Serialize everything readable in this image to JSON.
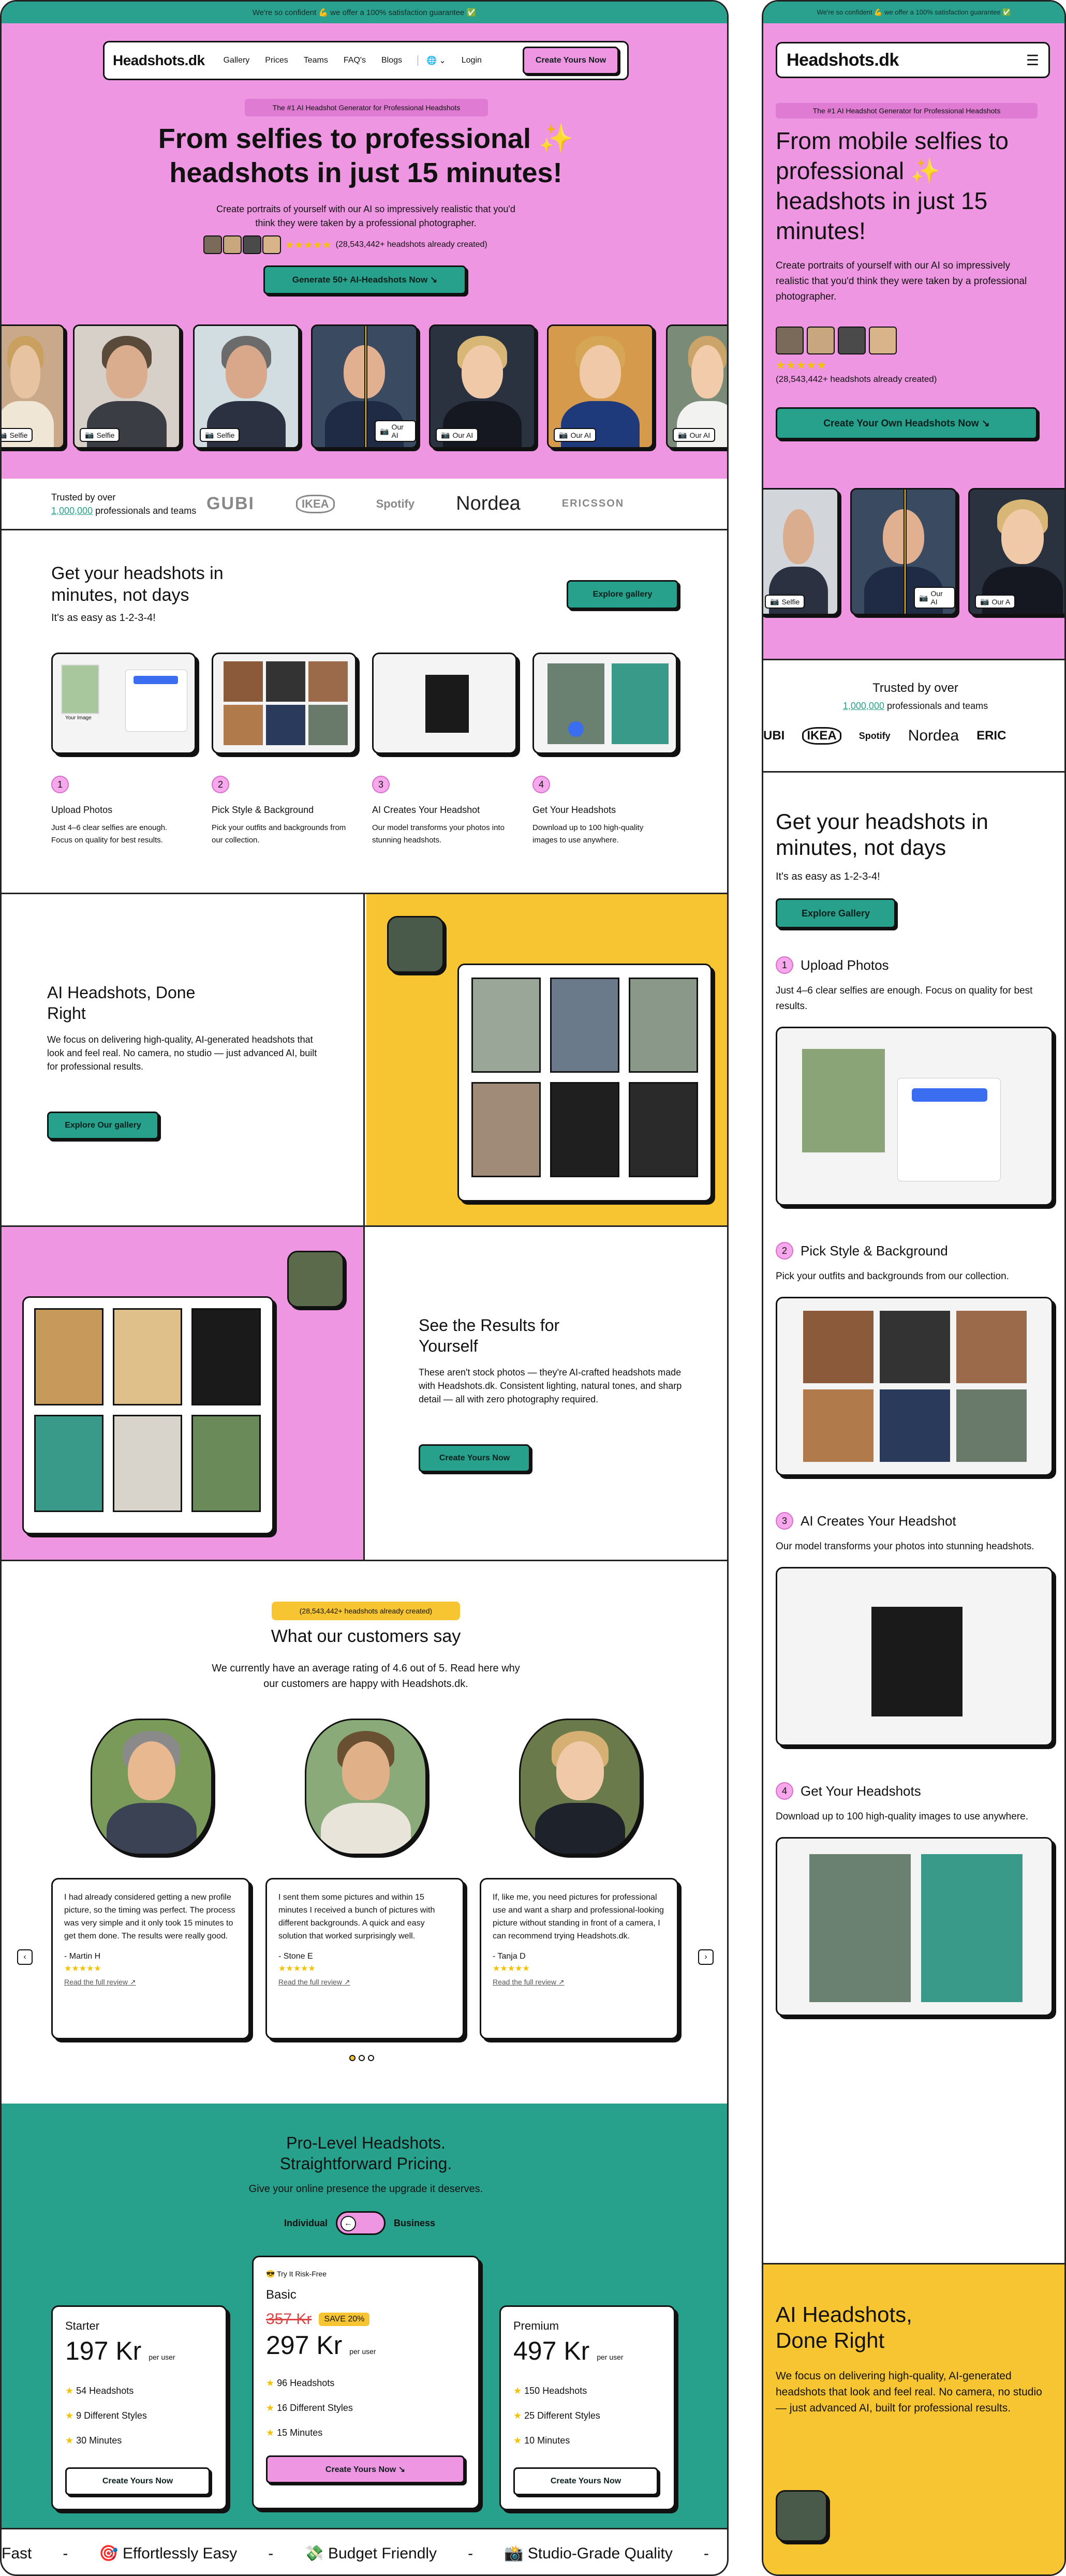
{
  "banner": "We're so confident 💪 we offer a 100% satisfaction guarantee ✅",
  "brand": "Headshots.dk",
  "nav": {
    "gallery": "Gallery",
    "prices": "Prices",
    "teams": "Teams",
    "faqs": "FAQ's",
    "blogs": "Blogs",
    "login": "Login",
    "cta": "Create Yours Now"
  },
  "hero": {
    "badge": "The #1 AI Headshot Generator for Professional Headshots",
    "title_line1": "From selfies to professional ✨",
    "title_line2": "headshots in just 15 minutes!",
    "subtitle": "Create portraits of yourself with our AI so impressively realistic that you'd think they were taken by a professional photographer.",
    "count_text": "(28,543,442+ headshots already created)",
    "cta": "Generate 50+ AI-Headshots Now ↘",
    "tags": [
      "Selfie",
      "Selfie",
      "Selfie",
      "Our AI",
      "Our AI",
      "Our AI",
      "Our AI"
    ]
  },
  "trusted": {
    "line1": "Trusted by over",
    "count": "1,000,000",
    "line2": "professionals and teams",
    "logos": [
      "GUBI",
      "IKEA",
      "Spotify",
      "Nordea",
      "ERICSSON"
    ]
  },
  "steps": {
    "title": "Get your headshots in minutes, not days",
    "subtitle": "It's as easy as 1-2-3-4!",
    "explore": "Explore gallery",
    "items": [
      {
        "num": "1",
        "title": "Upload Photos",
        "desc": "Just 4–6 clear selfies are enough. Focus on quality for best results."
      },
      {
        "num": "2",
        "title": "Pick Style & Background",
        "desc": "Pick your outfits and backgrounds from our collection."
      },
      {
        "num": "3",
        "title": "AI Creates Your Headshot",
        "desc": "Our model transforms your photos into stunning headshots."
      },
      {
        "num": "4",
        "title": "Get Your Headshots",
        "desc": "Download up to 100 high-quality images to use anywhere."
      }
    ],
    "upload_mock": {
      "upload": "Upload",
      "from_phone": "Upload from phone",
      "recent": "Select Recent Photos",
      "your_image": "Your Image"
    }
  },
  "done_right": {
    "title": "AI Headshots, Done Right",
    "body": "We focus on delivering high-quality, AI-generated headshots that look and feel real. No camera, no studio — just advanced AI, built for professional results.",
    "cta": "Explore Our gallery"
  },
  "results": {
    "title": "See the Results for Yourself",
    "body": "These aren't stock photos — they're AI-crafted headshots made with Headshots.dk. Consistent lighting, natural tones, and sharp detail — all with zero photography required.",
    "cta": "Create Yours Now"
  },
  "reviews": {
    "badge": "(28,543,442+ headshots already created)",
    "title": "What our customers say",
    "subtitle": "We currently have an average rating of 4.6 out of 5. Read here why our customers are happy with Headshots.dk.",
    "read_more": "Read the full review",
    "items": [
      {
        "text": "I had already considered getting a new profile picture, so the timing was perfect. The process was very simple and it only took 15 minutes to get them done. The results were really good.",
        "name": "- Martin H"
      },
      {
        "text": "I sent them some pictures and within 15 minutes I received a bunch of pictures with different backgrounds. A quick and easy solution that worked surprisingly well.",
        "name": "- Stone E"
      },
      {
        "text": "If, like me, you need pictures for professional use and want a sharp and professional-looking picture without standing in front of a camera, I can recommend trying Headshots.dk.",
        "name": "- Tanja D"
      }
    ]
  },
  "pricing": {
    "title_line1": "Pro-Level Headshots.",
    "title_line2": "Straightforward Pricing.",
    "subtitle": "Give your online presence the upgrade it deserves.",
    "toggle_left": "Individual",
    "toggle_right": "Business",
    "per_user": "per user",
    "plans": [
      {
        "name": "Starter",
        "price": "197 Kr",
        "features": [
          "54 Headshots",
          "9 Different Styles",
          "30 Minutes"
        ],
        "cta": "Create Yours Now"
      },
      {
        "name": "Basic",
        "try": "😎 Try It Risk-Free",
        "old": "357 Kr",
        "save": "SAVE 20%",
        "price": "297 Kr",
        "features": [
          "96 Headshots",
          "16 Different Styles",
          "15 Minutes"
        ],
        "cta": "Create Yours Now ↘"
      },
      {
        "name": "Premium",
        "price": "497 Kr",
        "features": [
          "150 Headshots",
          "25 Different Styles",
          "10 Minutes"
        ],
        "cta": "Create Yours Now"
      }
    ]
  },
  "ticker": [
    "Fast",
    "🎯 Effortlessly Easy",
    "💸 Budget Friendly",
    "📸 Studio-Grade Quality"
  ],
  "mobile": {
    "title": "From mobile selfies to professional ✨ headshots in just 15 minutes!",
    "cta": "Create Your Own Headshots Now ↘",
    "tags": [
      "Selfie",
      "Our AI",
      "Our A"
    ],
    "logos": [
      "UBI",
      "IKEA",
      "Spotify",
      "Nordea",
      "ERIC"
    ],
    "step_descs": [
      "Just 4–6 clear selfies are enough. Focus on quality for best results.",
      "Pick your outfits and backgrounds from our collection.",
      "Our model transforms your photos into stunning headshots.",
      "Download up to 100 high-quality images to use anywhere."
    ],
    "explore": "Explore Gallery"
  }
}
